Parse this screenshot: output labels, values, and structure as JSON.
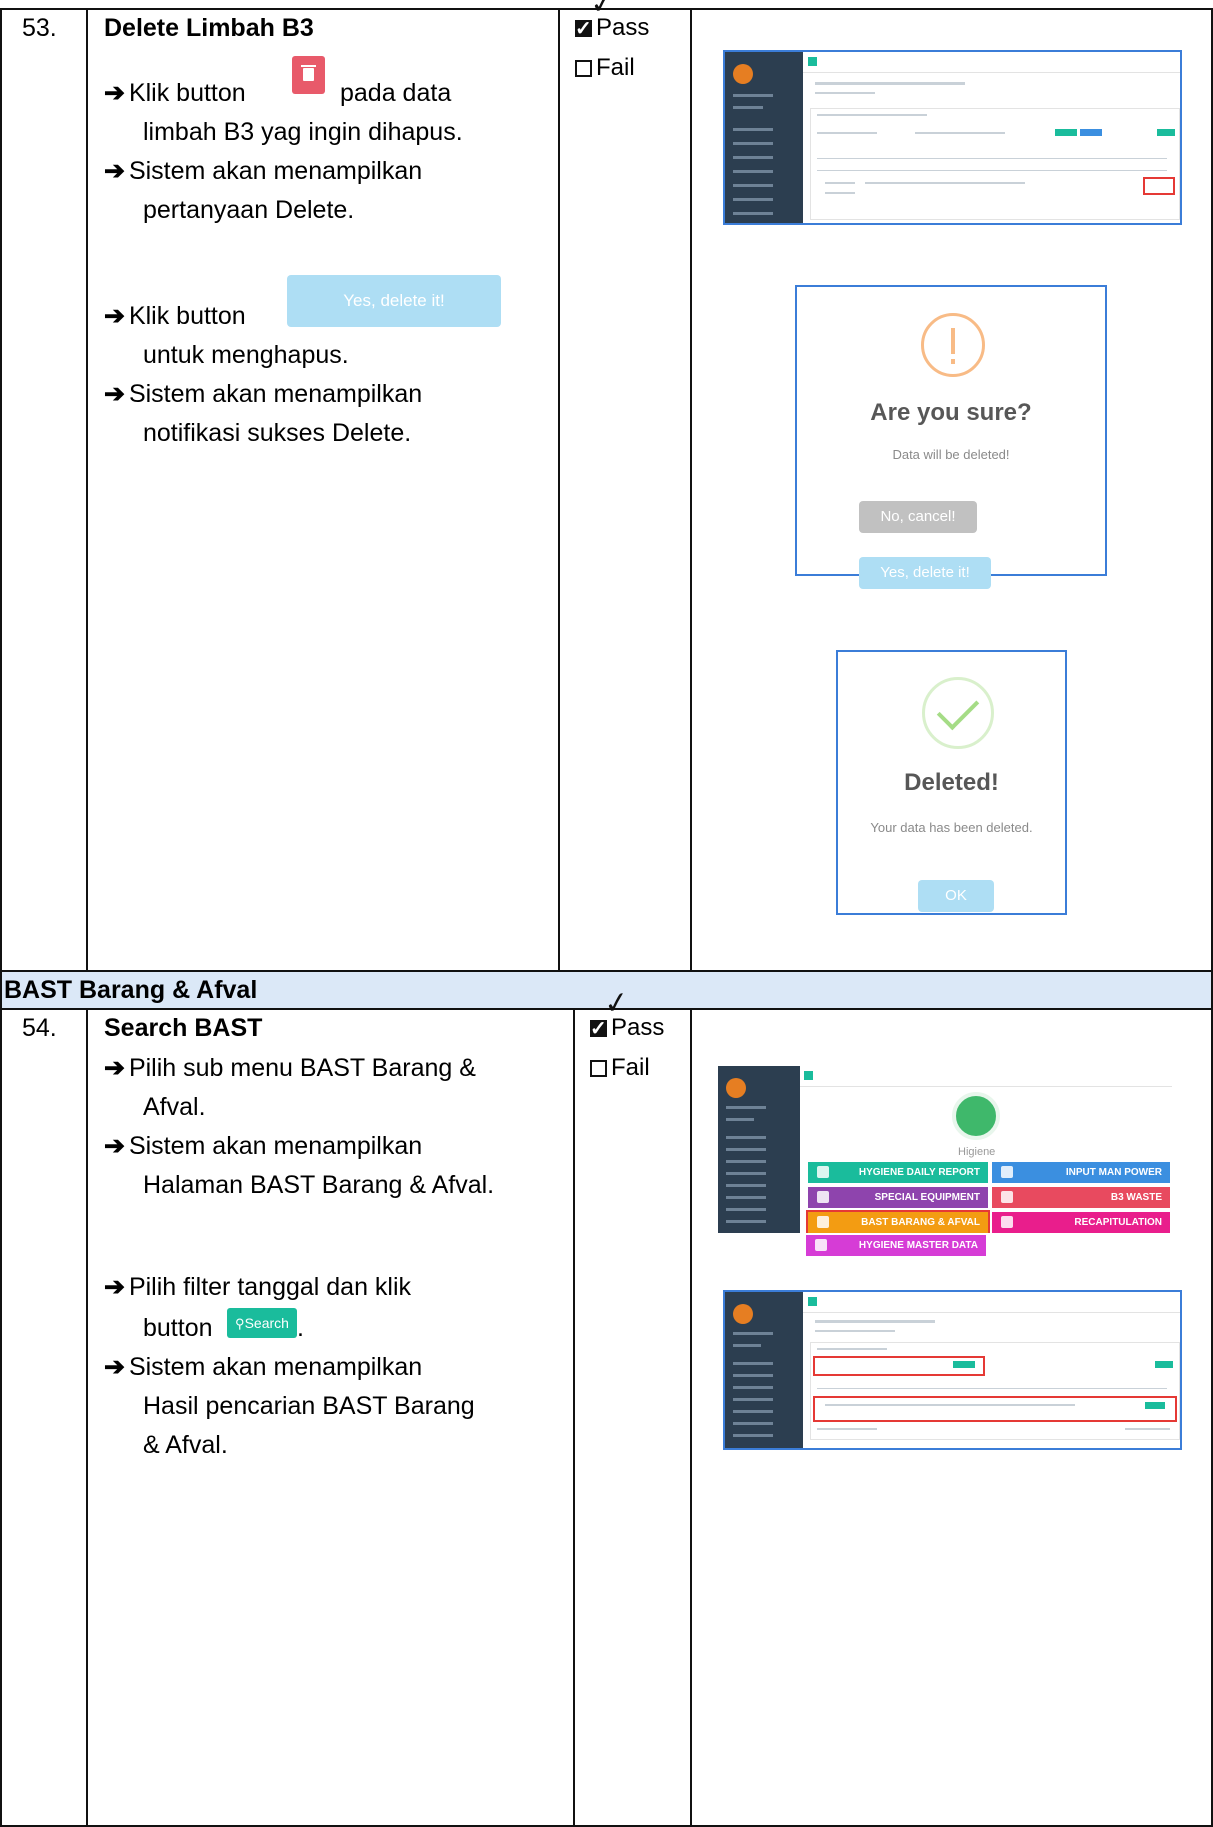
{
  "row53": {
    "number": "53.",
    "title": "Delete Limbah B3",
    "steps": [
      "Klik button",
      "pada data",
      "limbah B3 yag ingin dihapus.",
      "Sistem akan menampilkan",
      "pertanyaan Delete.",
      "Klik button",
      "untuk menghapus.",
      "Sistem akan menampilkan",
      "notifikasi sukses Delete."
    ],
    "inline_delete_icon": "trash-icon",
    "inline_yes_button": "Yes, delete it!",
    "pass_label": "Pass",
    "fail_label": "Fail",
    "confirm_dialog": {
      "title": "Are you sure?",
      "text": "Data will be deleted!",
      "cancel": "No, cancel!",
      "confirm": "Yes, delete it!"
    },
    "success_dialog": {
      "title": "Deleted!",
      "text": "Your data has been deleted.",
      "ok": "OK"
    }
  },
  "section": {
    "title": "BAST Barang & Afval"
  },
  "row54": {
    "number": "54.",
    "title": "Search BAST",
    "steps": [
      "Pilih sub menu BAST Barang &",
      "Afval.",
      "Sistem akan menampilkan",
      "Halaman BAST Barang & Afval.",
      "Pilih filter tanggal dan klik",
      "button",
      "Sistem akan menampilkan",
      "Hasil pencarian BAST Barang",
      "& Afval."
    ],
    "inline_search_button": "Search",
    "pass_label": "Pass",
    "fail_label": "Fail",
    "menu": {
      "heading": "Higiene",
      "tiles": [
        {
          "label": "HYGIENE DAILY REPORT",
          "color": "#1abc9c"
        },
        {
          "label": "INPUT MAN POWER",
          "color": "#3b8fe0"
        },
        {
          "label": "SPECIAL EQUIPMENT",
          "color": "#8e44ad"
        },
        {
          "label": "B3 WASTE",
          "color": "#e84a5f"
        },
        {
          "label": "BAST BARANG & AFVAL",
          "color": "#f39c12"
        },
        {
          "label": "RECAPITULATION",
          "color": "#e91e8c"
        },
        {
          "label": "HYGIENE MASTER DATA",
          "color": "#d63cd6"
        }
      ]
    }
  },
  "colors": {
    "border": "#111111",
    "section_bg": "#dbe8f7",
    "frame_blue": "#3b7dd8",
    "warning_orange": "#f8bb86",
    "success_green": "#a5dc86",
    "confirm_blue": "#aedef4",
    "cancel_gray": "#c1c1c1",
    "delete_red": "#e85a6a",
    "search_green": "#1abc9c"
  }
}
